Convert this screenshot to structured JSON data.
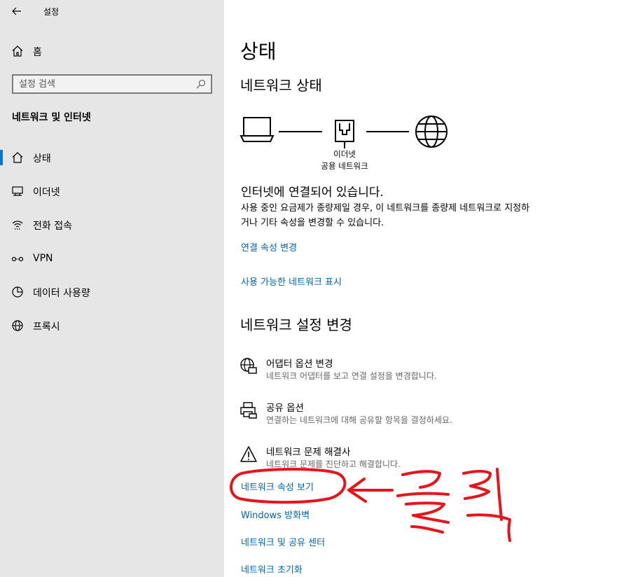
{
  "window": {
    "title": "설정"
  },
  "sidebar": {
    "home_label": "홈",
    "search_placeholder": "설정 검색",
    "section_title": "네트워크 및 인터넷",
    "items": [
      {
        "label": "상태",
        "icon": "home-network-icon",
        "selected": true
      },
      {
        "label": "이더넷",
        "icon": "ethernet-icon",
        "selected": false
      },
      {
        "label": "전화 접속",
        "icon": "dialup-icon",
        "selected": false
      },
      {
        "label": "VPN",
        "icon": "vpn-icon",
        "selected": false
      },
      {
        "label": "데이터 사용량",
        "icon": "data-usage-icon",
        "selected": false
      },
      {
        "label": "프록시",
        "icon": "globe-icon",
        "selected": false
      }
    ]
  },
  "main": {
    "title": "상태",
    "network_status_heading": "네트워크 상태",
    "diagram": {
      "adapter_label": "이더넷",
      "network_label": "공용 네트워크"
    },
    "connected_title": "인터넷에 연결되어 있습니다.",
    "connected_desc": "사용 중인 요금제가 종량제일 경우, 이 네트워크를 종량제 네트워크로 지정하거나 기타 속성을 변경할 수 있습니다.",
    "link_change_props": "연결 속성 변경",
    "link_show_networks": "사용 가능한 네트워크 표시",
    "change_settings_heading": "네트워크 설정 변경",
    "options": [
      {
        "title": "어댑터 옵션 변경",
        "desc": "네트워크 어댑터를 보고 연결 설정을 변경합니다.",
        "icon": "adapter-globe-icon"
      },
      {
        "title": "공유 옵션",
        "desc": "연결하는 네트워크에 대해 공유할 항목을 결정하세요.",
        "icon": "sharing-printer-icon"
      },
      {
        "title": "네트워크 문제 해결사",
        "desc": "네트워크 문제를 진단하고 해결합니다.",
        "icon": "warning-icon"
      }
    ],
    "links": [
      "네트워크 속성 보기",
      "Windows 방화벽",
      "네트워크 및 공유 센터",
      "네트워크 초기화"
    ]
  },
  "annotation": {
    "text": "클릭",
    "color": "#e8141b"
  },
  "colors": {
    "accent": "#0078d7",
    "link": "#0063b1",
    "sidebar_bg": "#e6e6e6"
  }
}
